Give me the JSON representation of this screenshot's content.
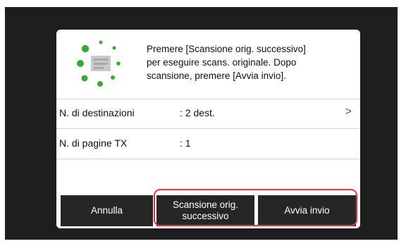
{
  "dialog": {
    "message_lines": [
      "Premere [Scansione orig. successivo]",
      "per eseguire scans. originale. Dopo",
      "scansione, premere [Avvia invio]."
    ],
    "icon": "scan-progress-icon"
  },
  "rows": [
    {
      "label": "N. di destinazioni",
      "value": ": 2 dest.",
      "chevron": ">"
    },
    {
      "label": "N. di pagine TX",
      "value": ": 1"
    }
  ],
  "buttons": {
    "cancel": "Annulla",
    "next_scan_line1": "Scansione orig.",
    "next_scan_line2": "successivo",
    "start_send": "Avvia invio"
  },
  "colors": {
    "scan_dot": "#3aaa35",
    "button_bg": "#262626",
    "highlight": "#e8323c"
  }
}
